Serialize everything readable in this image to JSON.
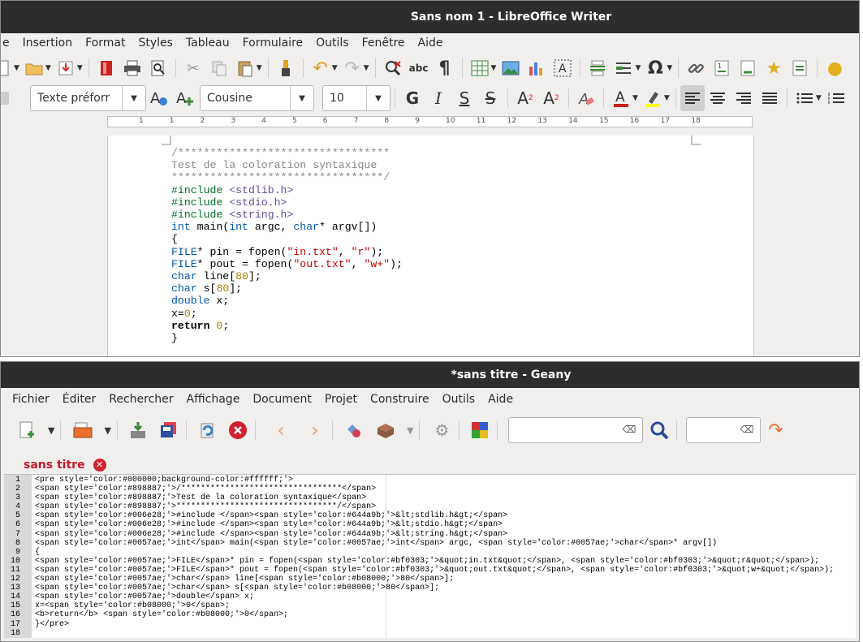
{
  "writer": {
    "title": "Sans nom 1 - LibreOffice Writer",
    "menu": [
      "e",
      "Insertion",
      "Format",
      "Styles",
      "Tableau",
      "Formulaire",
      "Outils",
      "Fenêtre",
      "Aide"
    ],
    "paragraph_style": "Texte préforr",
    "font_name": "Cousine",
    "font_size": "10",
    "ruler_numbers": [
      "1",
      "1",
      "2",
      "3",
      "4",
      "5",
      "6",
      "7",
      "8",
      "9",
      "10",
      "11",
      "12",
      "13",
      "14",
      "15",
      "16",
      "17",
      "18"
    ],
    "icons": {
      "bold": "G",
      "italic": "I",
      "underline": "S",
      "strike": "S",
      "superscript": "A",
      "subscript": "A",
      "special_char": "Ω",
      "spell": "abc",
      "pilcrow": "¶"
    },
    "code_lines": [
      [
        {
          "t": "/*********************************",
          "c": "#898887"
        }
      ],
      [
        {
          "t": "Test de la coloration syntaxique",
          "c": "#898887"
        }
      ],
      [
        {
          "t": "*********************************/",
          "c": "#898887"
        }
      ],
      [
        {
          "t": "#include ",
          "c": "#006e28"
        },
        {
          "t": "<stdlib.h>",
          "c": "#644a9b"
        }
      ],
      [
        {
          "t": "#include ",
          "c": "#006e28"
        },
        {
          "t": "<stdio.h>",
          "c": "#644a9b"
        }
      ],
      [
        {
          "t": "#include ",
          "c": "#006e28"
        },
        {
          "t": "<string.h>",
          "c": "#644a9b"
        }
      ],
      [
        {
          "t": "int",
          "c": "#0057ae"
        },
        {
          "t": " main(",
          "c": "#000000"
        },
        {
          "t": "int",
          "c": "#0057ae"
        },
        {
          "t": " argc, ",
          "c": "#000000"
        },
        {
          "t": "char",
          "c": "#0057ae"
        },
        {
          "t": "* argv[])",
          "c": "#000000"
        }
      ],
      [
        {
          "t": "{",
          "c": "#000000"
        }
      ],
      [
        {
          "t": "FILE",
          "c": "#0057ae"
        },
        {
          "t": "* pin = fopen(",
          "c": "#000000"
        },
        {
          "t": "\"in.txt\"",
          "c": "#bf0303"
        },
        {
          "t": ", ",
          "c": "#000000"
        },
        {
          "t": "\"r\"",
          "c": "#bf0303"
        },
        {
          "t": ");",
          "c": "#000000"
        }
      ],
      [
        {
          "t": "FILE",
          "c": "#0057ae"
        },
        {
          "t": "* pout = fopen(",
          "c": "#000000"
        },
        {
          "t": "\"out.txt\"",
          "c": "#bf0303"
        },
        {
          "t": ", ",
          "c": "#000000"
        },
        {
          "t": "\"w+\"",
          "c": "#bf0303"
        },
        {
          "t": ");",
          "c": "#000000"
        }
      ],
      [
        {
          "t": "char",
          "c": "#0057ae"
        },
        {
          "t": " line[",
          "c": "#000000"
        },
        {
          "t": "80",
          "c": "#b08000"
        },
        {
          "t": "];",
          "c": "#000000"
        }
      ],
      [
        {
          "t": "char",
          "c": "#0057ae"
        },
        {
          "t": " s[",
          "c": "#000000"
        },
        {
          "t": "80",
          "c": "#b08000"
        },
        {
          "t": "];",
          "c": "#000000"
        }
      ],
      [
        {
          "t": "double",
          "c": "#0057ae"
        },
        {
          "t": " x;",
          "c": "#000000"
        }
      ],
      [
        {
          "t": "x=",
          "c": "#000000"
        },
        {
          "t": "0",
          "c": "#b08000"
        },
        {
          "t": ";",
          "c": "#000000"
        }
      ],
      [
        {
          "t": "return",
          "c": "#000000",
          "b": true
        },
        {
          "t": " ",
          "c": "#000000"
        },
        {
          "t": "0",
          "c": "#b08000"
        },
        {
          "t": ";",
          "c": "#000000"
        }
      ],
      [
        {
          "t": "}",
          "c": "#000000"
        }
      ]
    ]
  },
  "geany": {
    "title": "*sans titre - Geany",
    "menu": [
      "Fichier",
      "Éditer",
      "Rechercher",
      "Affichage",
      "Document",
      "Projet",
      "Construire",
      "Outils",
      "Aide"
    ],
    "tab_label": "sans titre",
    "line_numbers": [
      "1",
      "2",
      "3",
      "4",
      "5",
      "6",
      "7",
      "8",
      "9",
      "10",
      "11",
      "12",
      "13",
      "14",
      "15",
      "16",
      "17",
      "18"
    ],
    "code_lines": [
      "<pre style='color:#000000;background-color:#ffffff;'>",
      "<span style='color:#898887;'>/*********************************</span>",
      "<span style='color:#898887;'>Test de la coloration syntaxique</span>",
      "<span style='color:#898887;'>*********************************/</span>",
      "<span style='color:#006e28;'>#include </span><span style='color:#644a9b;'>&lt;stdlib.h&gt;</span>",
      "<span style='color:#006e28;'>#include </span><span style='color:#644a9b;'>&lt;stdio.h&gt;</span>",
      "<span style='color:#006e28;'>#include </span><span style='color:#644a9b;'>&lt;string.h&gt;</span>",
      "<span style='color:#0057ae;'>int</span> main(<span style='color:#0057ae;'>int</span> argc, <span style='color:#0057ae;'>char</span>* argv[])",
      "{",
      "<span style='color:#0057ae;'>FILE</span>* pin = fopen(<span style='color:#bf0303;'>&quot;in.txt&quot;</span>, <span style='color:#bf0303;'>&quot;r&quot;</span>);",
      "<span style='color:#0057ae;'>FILE</span>* pout = fopen(<span style='color:#bf0303;'>&quot;out.txt&quot;</span>, <span style='color:#bf0303;'>&quot;w+&quot;</span>);",
      "<span style='color:#0057ae;'>char</span> line[<span style='color:#b08000;'>80</span>];",
      "<span style='color:#0057ae;'>char</span> s[<span style='color:#b08000;'>80</span>];",
      "<span style='color:#0057ae;'>double</span> x;",
      "x=<span style='color:#b08000;'>0</span>;",
      "<b>return</b> <span style='color:#b08000;'>0</span>;",
      "}</pre>",
      ""
    ]
  }
}
